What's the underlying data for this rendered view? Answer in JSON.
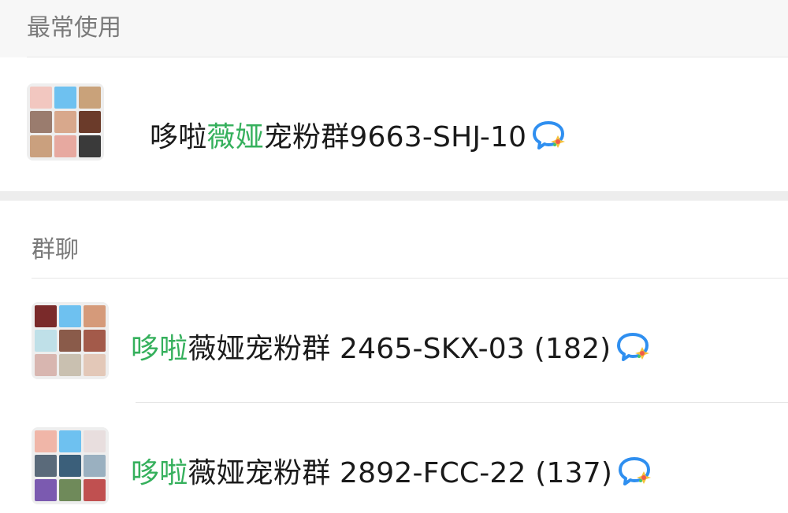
{
  "sections": {
    "recent": {
      "title": "最常使用"
    },
    "groups": {
      "title": "群聊"
    }
  },
  "recent_items": [
    {
      "name_pre": "哆啦",
      "name_hl": "薇娅",
      "name_post": "宠粉群9663-SHJ-10",
      "avatar_colors": [
        "#f2c7c0",
        "#6ec1f0",
        "#c9a27a",
        "#9a7c6e",
        "#d8a88c",
        "#6b3b2a",
        "#caa07e",
        "#e7a9a0",
        "#3a3a3a"
      ],
      "icon": "chat-bubble-icon"
    }
  ],
  "group_items": [
    {
      "name_pre": "",
      "name_hl": "哆啦",
      "name_post": "薇娅宠粉群 2465-SKX-03 (182)",
      "avatar_colors": [
        "#7a2a2a",
        "#6ec1f0",
        "#d59a7a",
        "#bfe0e8",
        "#8a5b4a",
        "#a35a4a",
        "#d8b6b0",
        "#c9c0b0",
        "#e3c8b8"
      ],
      "icon": "chat-bubble-icon"
    },
    {
      "name_pre": "",
      "name_hl": "哆啦",
      "name_post": "薇娅宠粉群 2892-FCC-22 (137)",
      "avatar_colors": [
        "#f0b6a8",
        "#6ec1f0",
        "#e8dede",
        "#5a6a7a",
        "#3b5f7a",
        "#9ab0c0",
        "#7b5ab0",
        "#6f8a5a",
        "#c05050"
      ],
      "icon": "chat-bubble-icon"
    }
  ],
  "colors": {
    "highlight": "#35b05c",
    "icon_blue": "#2f8ff0",
    "icon_yellow": "#f5c23a",
    "icon_green": "#45c36a",
    "icon_red": "#f05a4a"
  }
}
